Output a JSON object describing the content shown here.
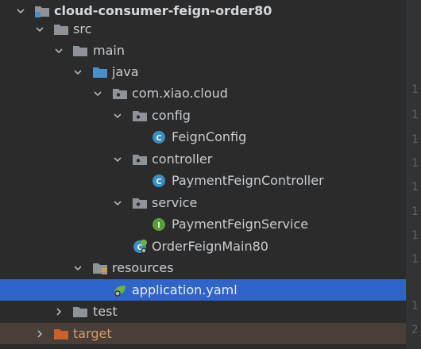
{
  "tree": {
    "project": "cloud-consumer-feign-order80",
    "src": "src",
    "main": "main",
    "java": "java",
    "package": "com.xiao.cloud",
    "config": "config",
    "feign_config": "FeignConfig",
    "controller": "controller",
    "payment_controller": "PaymentFeignController",
    "service": "service",
    "payment_service": "PaymentFeignService",
    "main_class": "OrderFeignMain80",
    "resources": "resources",
    "application_yaml": "application.yaml",
    "test": "test",
    "target": "target"
  },
  "gutter": {
    "line_numbers": [
      "1",
      "1",
      "1",
      "1",
      "1",
      "1",
      "1",
      "1",
      "1",
      "2"
    ]
  },
  "colors": {
    "background": "#2b2b2b",
    "selection": "#2f65ca",
    "excluded_row": "#4a3f38",
    "folder": "#8d9399",
    "source_folder": "#4a90c8",
    "class_icon": "#3a8fc0",
    "interface_icon": "#5a9e3c",
    "target_folder": "#c8622a"
  },
  "icons": {
    "expanded": "chevron-down-icon",
    "collapsed": "chevron-right-icon",
    "module": "module-folder-icon",
    "folder": "folder-icon",
    "source_folder": "source-folder-icon",
    "package": "package-icon",
    "class": "class-icon",
    "interface": "interface-icon",
    "main_class": "spring-boot-class-icon",
    "resources": "resources-folder-icon",
    "yaml": "spring-yaml-icon",
    "excluded": "excluded-folder-icon"
  }
}
